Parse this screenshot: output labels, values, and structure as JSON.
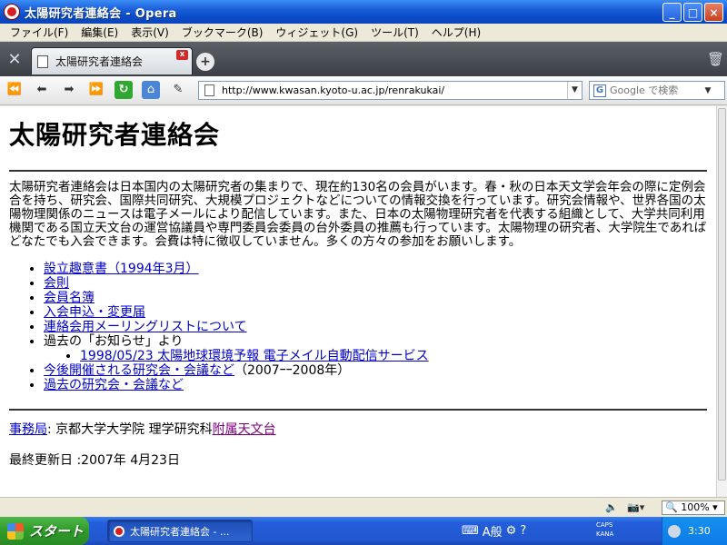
{
  "window": {
    "title": "太陽研究者連絡会 - Opera",
    "minimize_label": "_",
    "maximize_label": "□",
    "close_label": "×"
  },
  "menu": {
    "items": [
      "ファイル(F)",
      "編集(E)",
      "表示(V)",
      "ブックマーク(B)",
      "ウィジェット(G)",
      "ツール(T)",
      "ヘルプ(H)"
    ]
  },
  "tabs": {
    "active_label": "太陽研究者連絡会",
    "close_label": "x",
    "new_tab_label": "+"
  },
  "toolbar": {
    "url": "http://www.kwasan.kyoto-u.ac.jp/renrakukai/",
    "search_placeholder": "Google で検索",
    "search_engine_glyph": "G"
  },
  "page": {
    "title": "太陽研究者連絡会",
    "intro": "太陽研究者連絡会は日本国内の太陽研究者の集まりで、現在約130名の会員がいます。春・秋の日本天文学会年会の際に定例会合を持ち、研究会、国際共同研究、大規模プロジェクトなどについての情報交換を行っています。研究会情報や、世界各国の太陽物理関係のニュースは電子メールにより配信しています。また、日本の太陽物理研究者を代表する組織として、大学共同利用機関である国立天文台の運営協議員や専門委員会委員の台外委員の推薦も行っています。太陽物理の研究者、大学院生であればどなたでも入会できます。会費は特に徴収していません。多くの方々の参加をお願いします。",
    "links": {
      "prospectus": "設立趣意書（1994年3月）",
      "rules": "会則",
      "members": "会員名簿",
      "join": "入会申込・変更届",
      "mailing_list": "連絡会用メーリングリストについて",
      "past_news_prefix": "過去の「お知らせ」より",
      "news_item": "1998/05/23 太陽地球環境予報 電子メイル自動配信サービス",
      "upcoming": "今後開催される研究会・会議など",
      "upcoming_suffix": "（2007ｰｰ2008年）",
      "past_meetings": "過去の研究会・会議など"
    },
    "office_link": "事務局",
    "office_text": ":  京都大学大学院 理学研究科",
    "observatory_link": "附属天文台",
    "updated": "最終更新日 :2007年 4月23日"
  },
  "statusbar": {
    "zoom": "100%"
  },
  "taskbar": {
    "start_label": "スタート",
    "task_label": "太陽研究者連絡会 - ...",
    "ime_label": "A般",
    "caps": "CAPS",
    "kana": "KANA",
    "clock": "3:30"
  }
}
